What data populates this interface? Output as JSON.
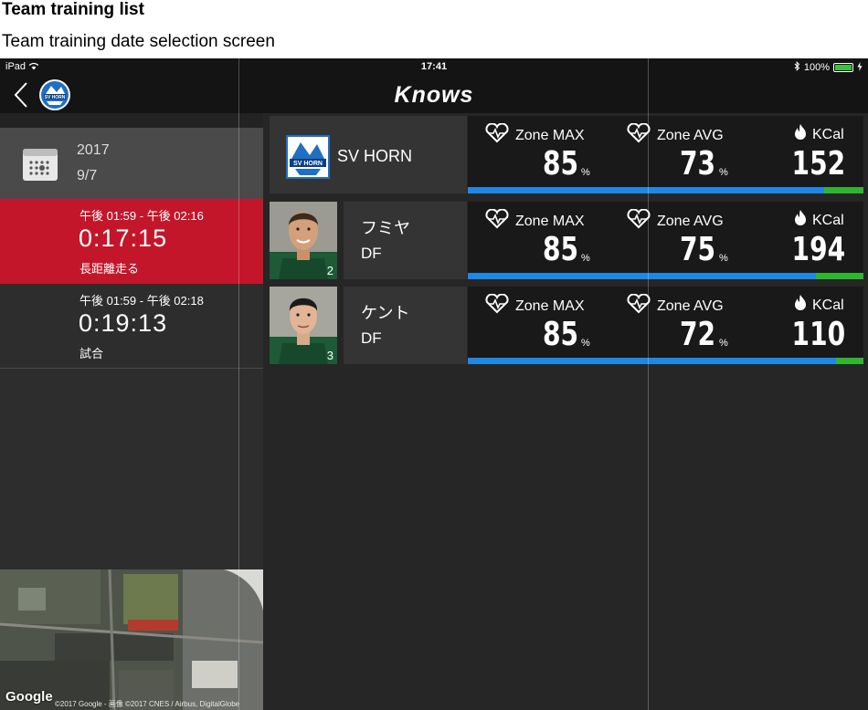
{
  "doc": {
    "title": "Team training list",
    "subtitle": "Team training date selection screen"
  },
  "status_bar": {
    "device": "iPad",
    "time": "17:41",
    "battery": "100%"
  },
  "nav": {
    "brand": "Knows",
    "back_icon": "chevron-left-icon",
    "team_logo_icon": "club-crest-icon"
  },
  "date_header": {
    "year": "2017",
    "month_day": "9/7",
    "icon": "calendar-icon"
  },
  "sessions": [
    {
      "time_range": "午後 01:59 - 午後 02:16",
      "duration": "0:17:15",
      "name": "長距離走る",
      "selected": true
    },
    {
      "time_range": "午後 01:59 - 午後 02:18",
      "duration": "0:19:13",
      "name": "試合",
      "selected": false
    }
  ],
  "map": {
    "logo": "Google",
    "copyright": "©2017 Google - 画像 ©2017 CNES / Airbus, DigitalGlobe"
  },
  "team": {
    "name": "SV HORN"
  },
  "stat_labels": {
    "zone_max": "Zone MAX",
    "zone_avg": "Zone AVG",
    "kcal": "KCal"
  },
  "unit_percent": "%",
  "rows": [
    {
      "zone_max": "85",
      "zone_avg": "73",
      "kcal": "152",
      "green_fraction": 0.1
    },
    {
      "name": "フミヤ",
      "position": "DF",
      "number": "2",
      "zone_max": "85",
      "zone_avg": "75",
      "kcal": "194",
      "green_fraction": 0.12
    },
    {
      "name": "ケント",
      "position": "DF",
      "number": "3",
      "zone_max": "85",
      "zone_avg": "72",
      "kcal": "110",
      "green_fraction": 0.07
    }
  ],
  "colors": {
    "selected_session": "#c4162a",
    "progress_blue": "#1e88e5",
    "progress_green": "#2fb52f"
  }
}
